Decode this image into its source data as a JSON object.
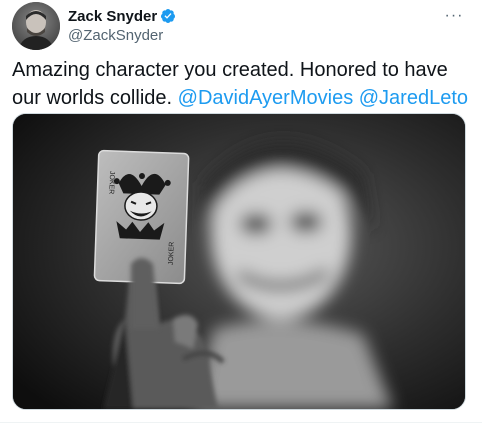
{
  "author": {
    "display_name": "Zack Snyder",
    "handle": "@ZackSnyder",
    "verified": true,
    "avatar_icon": "avatar-photo"
  },
  "menu": {
    "more_label": "···"
  },
  "tweet": {
    "text_plain": "Amazing character you created. Honored to have our worlds collide.",
    "mentions": [
      "@DavidAyerMovies",
      "@JaredLeto"
    ]
  },
  "media": {
    "description_icon": "joker-card-photo",
    "card_label": "JOKER"
  },
  "colors": {
    "accent": "#1d9bf0",
    "text": "#0f1419",
    "secondary": "#536471"
  }
}
